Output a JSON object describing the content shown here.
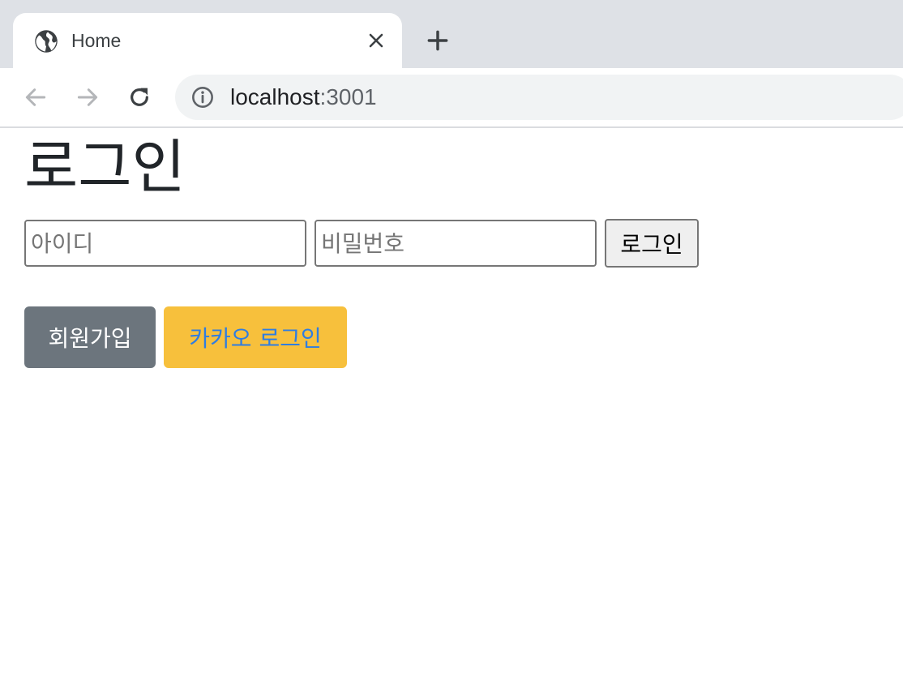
{
  "browser": {
    "tab": {
      "title": "Home",
      "icon": "globe-icon",
      "close_icon": "close-icon"
    },
    "new_tab_icon": "plus-icon",
    "nav": {
      "back_icon": "arrow-left-icon",
      "forward_icon": "arrow-right-icon",
      "reload_icon": "reload-icon"
    },
    "address": {
      "info_icon": "info-icon",
      "host": "localhost",
      "port": ":3001"
    }
  },
  "page": {
    "heading": "로그인",
    "form": {
      "id_placeholder": "아이디",
      "password_placeholder": "비밀번호",
      "submit_label": "로그인"
    },
    "actions": {
      "signup_label": "회원가입",
      "kakao_label": "카카오 로그인"
    }
  },
  "colors": {
    "signup_bg": "#6c757d",
    "kakao_bg": "#f7c03c",
    "kakao_text": "#2f7de1",
    "tabstrip_bg": "#dee1e6"
  }
}
